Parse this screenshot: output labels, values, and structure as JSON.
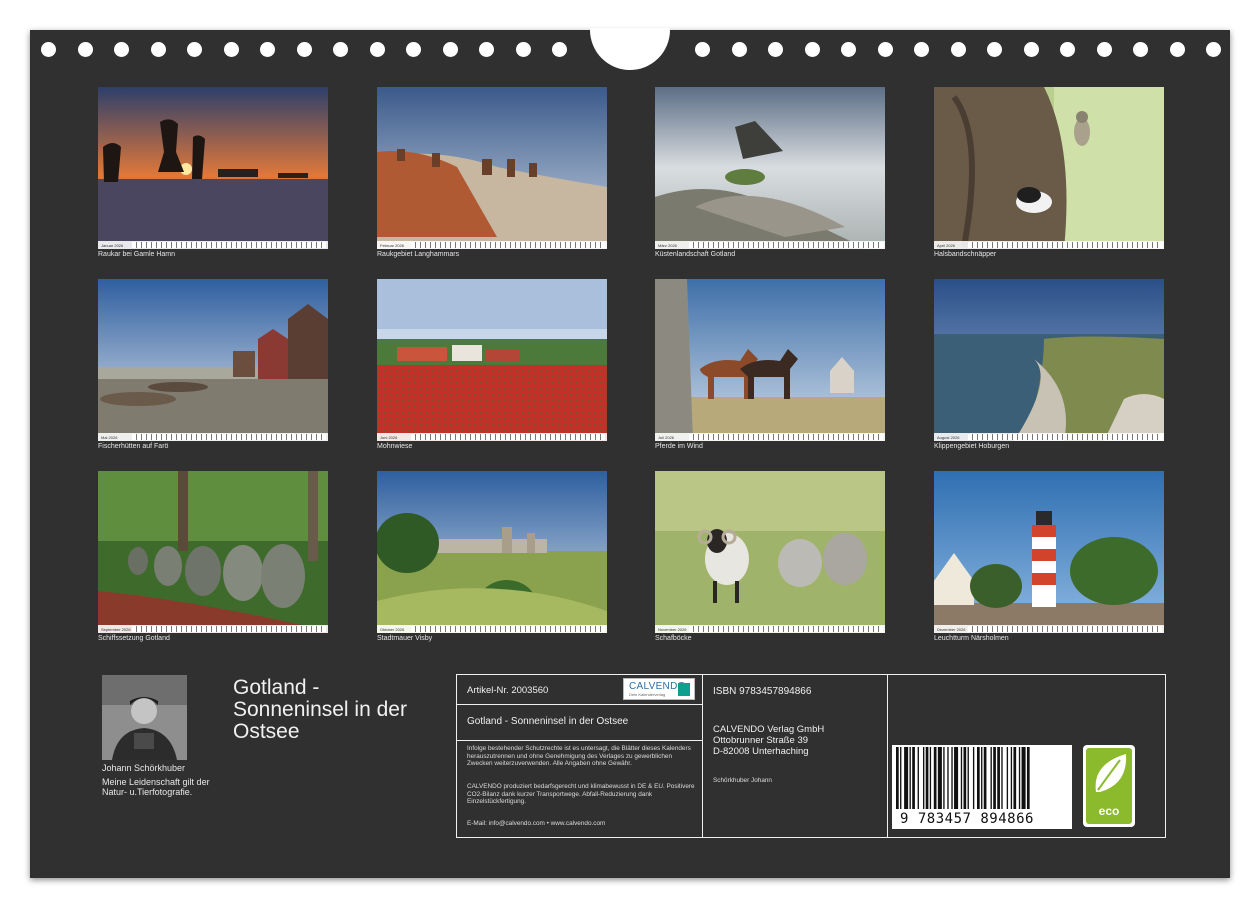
{
  "photos": [
    {
      "caption": "Raukar bei Gamle Hamn",
      "month": "Januar 2026"
    },
    {
      "caption": "Raukgebiet Langhammars",
      "month": "Februar 2026"
    },
    {
      "caption": "Küstenlandschaft Gotland",
      "month": "März 2026"
    },
    {
      "caption": "Halsbandschnäpper",
      "month": "April 2026"
    },
    {
      "caption": "Fischerhütten auf Farö",
      "month": "Mai 2026"
    },
    {
      "caption": "Mohnwiese",
      "month": "Juni 2026"
    },
    {
      "caption": "Pferde im Wind",
      "month": "Juli 2026"
    },
    {
      "caption": "Klippengebiet Hoburgen",
      "month": "August 2026"
    },
    {
      "caption": "Schiffssetzung Gotland",
      "month": "September 2026"
    },
    {
      "caption": "Stadtmauer Visby",
      "month": "Oktober 2026"
    },
    {
      "caption": "Schafböcke",
      "month": "November 2026"
    },
    {
      "caption": "Leuchtturm Närsholmen",
      "month": "Dezember 2026"
    }
  ],
  "author": {
    "name": "Johann Schörkhuber",
    "bio": "Meine Leidenschaft gilt der Natur- u.Tierfotografie."
  },
  "title": "Gotland - Sonneninsel in der Ostsee",
  "info": {
    "article": "Artikel-Nr. 2003560",
    "logo_name": "CALVENDO",
    "logo_sub": "Dein Kalenderverlag",
    "title_small": "Gotland - Sonneninsel in der Ostsee",
    "legal": "Infolge bestehender Schutzrechte ist es untersagt, die Blätter dieses Kalenders herauszutrennen und ohne Genehmigung des Verlages zu gewerblichen Zwecken weiterzuverwenden. Alle Angaben ohne Gewähr.",
    "eco_text": "CALVENDO produziert bedarfsgerecht und klimabewusst in DE & EU. Positivere CO2-Bilanz dank kurzer Transportwege. Abfall-Reduzierung dank Einzelstückfertigung.",
    "contact": "E-Mail: info@calvendo.com • www.calvendo.com",
    "isbn": "ISBN 9783457894866",
    "publisher_name": "CALVENDO Verlag GmbH",
    "publisher_street": "Ottobrunner Straße 39",
    "publisher_city": "D-82008 Unterhaching",
    "copyright": "Schörkhuber Johann",
    "barcode_digits": "9 783457 894866",
    "eco_label": "eco"
  },
  "colors": {
    "background": "#303030",
    "text": "#f0f0f0",
    "eco_green": "#8bbb2c",
    "logo_blue": "#2a6fa8"
  }
}
